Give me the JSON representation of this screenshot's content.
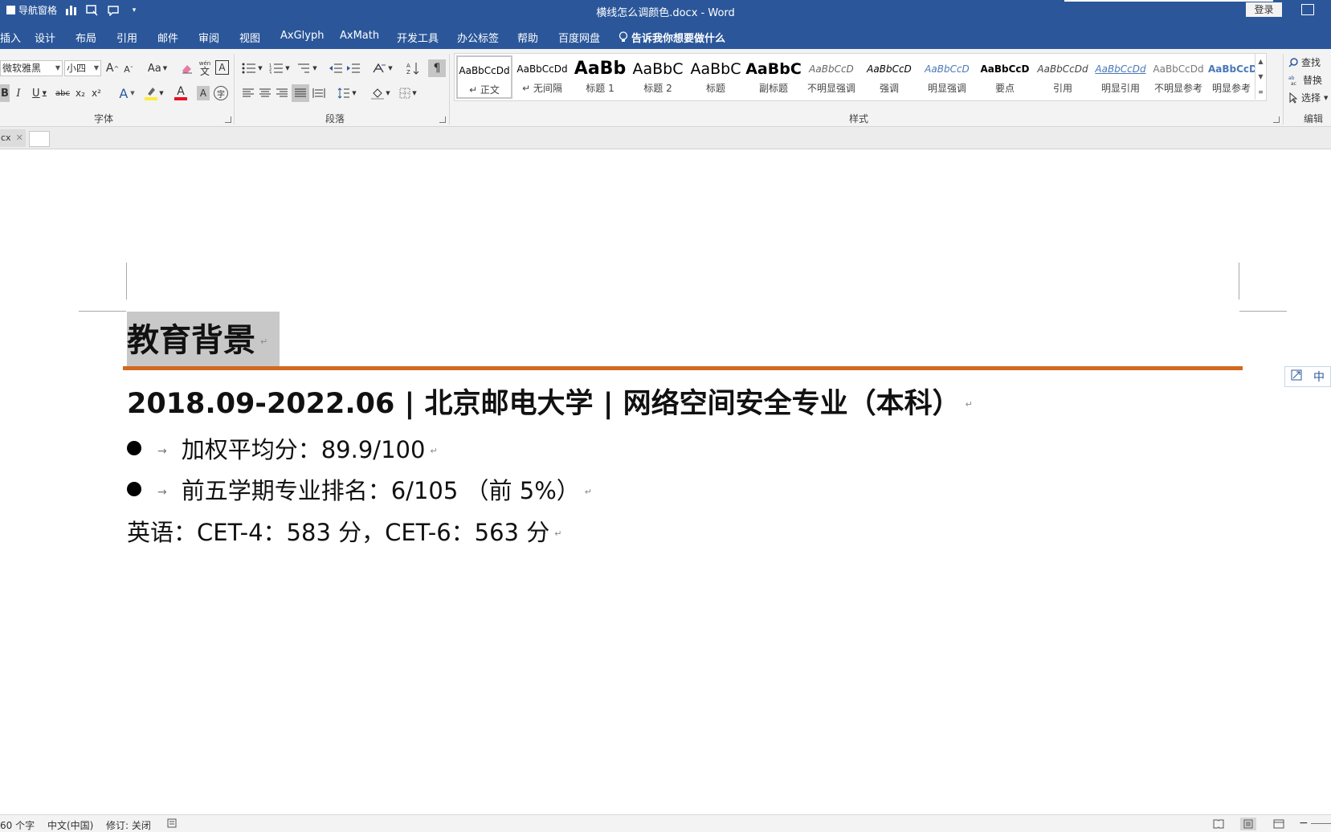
{
  "window": {
    "title": "横线怎么调颜色.docx  -  Word",
    "sign_in": "登录",
    "nav_pane_label": "导航窗格"
  },
  "tabs": [
    "插入",
    "设计",
    "布局",
    "引用",
    "邮件",
    "审阅",
    "视图",
    "AxGlyph",
    "AxMath",
    "开发工具",
    "办公标签",
    "帮助",
    "百度网盘"
  ],
  "tell_me": "告诉我你想要做什么",
  "ribbon": {
    "font": {
      "label": "字体",
      "family": "微软雅黑",
      "size": "小四",
      "case_label": "Aa",
      "phonetic_top": "wén",
      "phonetic_char": "文",
      "bordered_char": "A",
      "bold": "B",
      "italic": "I",
      "underline": "U",
      "strike": "abc",
      "sub": "x₂",
      "sup": "x²",
      "grow": "A",
      "shrink": "A",
      "effects": "A",
      "font_color": "A",
      "shading": "A",
      "enclose": "字"
    },
    "paragraph": {
      "label": "段落"
    },
    "styles": {
      "label": "样式",
      "items": [
        {
          "sample": "AaBbCcDd",
          "name": "↵ 正文"
        },
        {
          "sample": "AaBbCcDd",
          "name": "↵ 无间隔"
        },
        {
          "sample": "AaBb",
          "name": "标题 1"
        },
        {
          "sample": "AaBbC",
          "name": "标题 2"
        },
        {
          "sample": "AaBbC",
          "name": "标题"
        },
        {
          "sample": "AaBbC",
          "name": "副标题"
        },
        {
          "sample": "AaBbCcD",
          "name": "不明显强调"
        },
        {
          "sample": "AaBbCcD",
          "name": "强调"
        },
        {
          "sample": "AaBbCcD",
          "name": "明显强调"
        },
        {
          "sample": "AaBbCcD",
          "name": "要点"
        },
        {
          "sample": "AaBbCcDd",
          "name": "引用"
        },
        {
          "sample": "AaBbCcDd",
          "name": "明显引用"
        },
        {
          "sample": "AaBbCcDd",
          "name": "不明显参考"
        },
        {
          "sample": "AaBbCcDd",
          "name": "明显参考"
        }
      ]
    },
    "editing": {
      "label": "编辑",
      "find": "查找",
      "replace": "替换",
      "select": "选择"
    }
  },
  "doc_tab": {
    "name": "cx",
    "close": "✕"
  },
  "document": {
    "heading": "教育背景",
    "line1": "2018.09-2022.06 | 北京邮电大学 | 网络空间安全专业（本科）",
    "bullets": [
      "加权平均分：89.9/100",
      "前五学期专业排名：6/105 （前 5%）"
    ],
    "line4": "英语：CET-4：583 分，CET-6：563 分",
    "para_mark": "↵",
    "tab_mark": "→",
    "rule_color": "#d2691e",
    "float_ime": "中"
  },
  "status": {
    "word_count": "60 个字",
    "language": "中文(中国)",
    "track_changes": "修订: 关闭",
    "zoom_minus": "−"
  },
  "colors": {
    "title_bar": "#2b579a",
    "ribbon_bg": "#f3f3f3",
    "heading_highlight": "#c8c8c8"
  }
}
